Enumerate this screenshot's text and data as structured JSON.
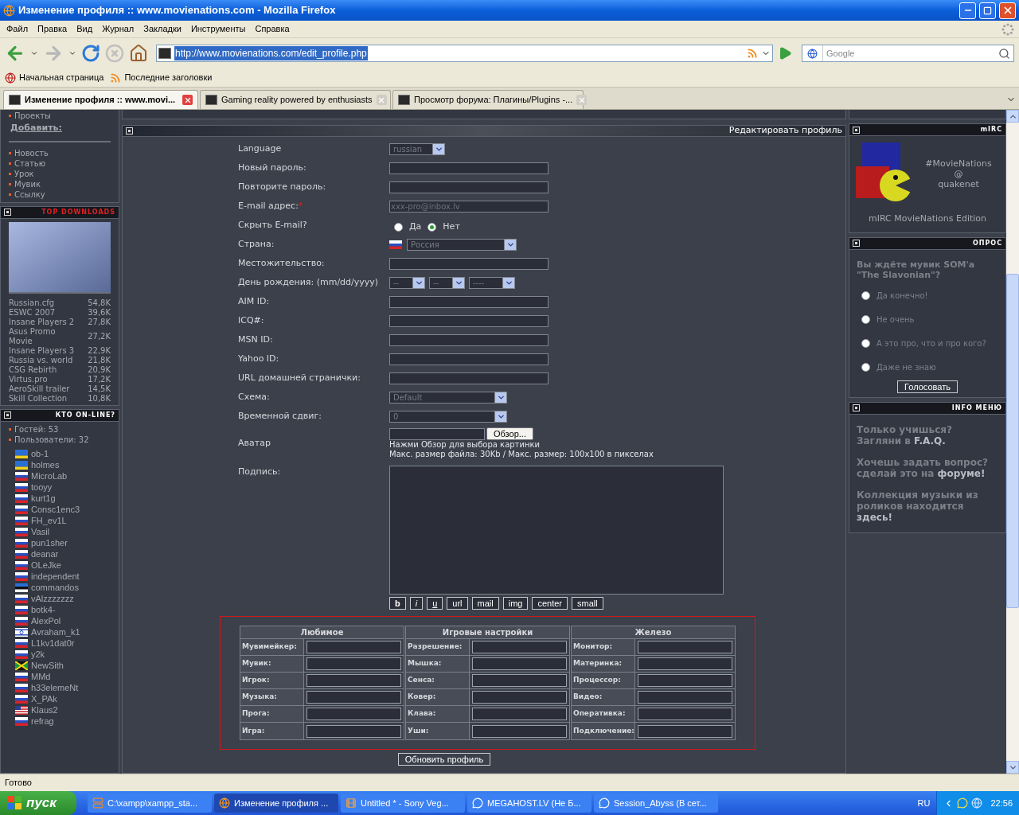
{
  "window": {
    "title": "Изменение профиля :: www.movienations.com - Mozilla Firefox"
  },
  "menu": [
    "Файл",
    "Правка",
    "Вид",
    "Журнал",
    "Закладки",
    "Инструменты",
    "Справка"
  ],
  "address": {
    "value": "http://www.movienations.com/edit_profile.php"
  },
  "search": {
    "placeholder": "Google"
  },
  "bookmarks": [
    "Начальная страница",
    "Последние заголовки"
  ],
  "tabs": [
    {
      "label": "Изменение профиля :: www.movi...",
      "selected": true
    },
    {
      "label": "Gaming reality powered by enthusiasts",
      "selected": false
    },
    {
      "label": "Просмотр форума: Плагины/Plugins -...",
      "selected": false
    }
  ],
  "left": {
    "links_top": [
      "Проекты"
    ],
    "add_title": "Добавить:",
    "add_links": [
      "Новость",
      "Статью",
      "Урок",
      "Мувик",
      "Ссылку"
    ],
    "downloads": {
      "title": "TOP DOWNLOADS",
      "items": [
        {
          "name": "Russian.cfg",
          "size": "54,8K"
        },
        {
          "name": "ESWC 2007",
          "size": "39,6K"
        },
        {
          "name": "Insane Players 2",
          "size": "27,8K"
        },
        {
          "name": "Asus Promo Movie",
          "size": "27,2K"
        },
        {
          "name": "Insane Players 3",
          "size": "22,9K"
        },
        {
          "name": "Russia vs. world",
          "size": "21,8K"
        },
        {
          "name": "CSG Rebirth",
          "size": "20,9K"
        },
        {
          "name": "Virtus.pro",
          "size": "17,2K"
        },
        {
          "name": "AeroSkill trailer",
          "size": "14,5K"
        },
        {
          "name": "Skill Collection",
          "size": "10,8K"
        }
      ]
    },
    "online": {
      "title": "КТО ON-LINE?",
      "stats": [
        "Гостей: 53",
        "Пользователи: 32"
      ],
      "users": [
        {
          "name": "ob-1",
          "kind": "ua"
        },
        {
          "name": "holmes",
          "kind": "ua"
        },
        {
          "name": "MicroLab",
          "kind": "ru"
        },
        {
          "name": "tooyy",
          "kind": "ru"
        },
        {
          "name": "kurt1g",
          "kind": "ru"
        },
        {
          "name": "Consc1enc3",
          "kind": "ru"
        },
        {
          "name": "FH_ev1L",
          "kind": "ru"
        },
        {
          "name": "Vasil",
          "kind": "ru"
        },
        {
          "name": "pun1sher",
          "kind": "ru"
        },
        {
          "name": "deanar",
          "kind": "ru"
        },
        {
          "name": "OLeJke",
          "kind": "ru"
        },
        {
          "name": "independent",
          "kind": "ru"
        },
        {
          "name": "commandos",
          "kind": "ee"
        },
        {
          "name": "vAlzzzzzzz",
          "kind": "ru"
        },
        {
          "name": "botk4-",
          "kind": "ru"
        },
        {
          "name": "AlexPol",
          "kind": "ru"
        },
        {
          "name": "Avraham_k1",
          "kind": "il"
        },
        {
          "name": "L1kv1dat0r",
          "kind": "ru"
        },
        {
          "name": "y2k",
          "kind": "ru"
        },
        {
          "name": "NewSith",
          "kind": "jm"
        },
        {
          "name": "MMd",
          "kind": "ru"
        },
        {
          "name": "h33elemeNt",
          "kind": "ru"
        },
        {
          "name": "X_PAk",
          "kind": "ru"
        },
        {
          "name": "Klaus2",
          "kind": "us"
        },
        {
          "name": "refrag",
          "kind": "ru"
        }
      ]
    }
  },
  "main": {
    "title": "Редактировать профиль",
    "fields": [
      {
        "kind": "select",
        "label": "Language",
        "value": "russian"
      },
      {
        "kind": "input",
        "label": "Новый пароль:"
      },
      {
        "kind": "input",
        "label": "Повторите пароль:"
      },
      {
        "kind": "input",
        "label": "E-mail адрес:",
        "mark": "*",
        "value": "xxx-pro@inbox.lv"
      },
      {
        "kind": "radio",
        "label": "Скрыть E-mail?",
        "options": [
          {
            "label": "Да",
            "selected": false
          },
          {
            "label": "Нет",
            "selected": true
          }
        ]
      },
      {
        "kind": "country",
        "label": "Страна:",
        "value": "Россия"
      },
      {
        "kind": "input",
        "label": "Местожительство:"
      },
      {
        "kind": "date",
        "label": "День рождения: (mm/dd/yyyy)",
        "parts": [
          "--",
          "--",
          "----"
        ]
      },
      {
        "kind": "input",
        "label": "AIM ID:"
      },
      {
        "kind": "input",
        "label": "ICQ#:"
      },
      {
        "kind": "input",
        "label": "MSN ID:"
      },
      {
        "kind": "input",
        "label": "Yahoo ID:"
      },
      {
        "kind": "input",
        "label": "URL домашней странички:"
      },
      {
        "kind": "select",
        "label": "Схема:",
        "value": "Default"
      },
      {
        "kind": "select",
        "label": "Временной сдвиг:",
        "value": "0"
      },
      {
        "kind": "file",
        "label": "Аватар",
        "button": "Обзор...",
        "hints": [
          "Нажми Обзор для выбора картинки",
          "Макс. размер файла: 30Kb / Макс. размер: 100x100 в пикселах"
        ]
      }
    ],
    "signature": {
      "label": "Подпись:",
      "buttons": [
        "b",
        "i",
        "u",
        "url",
        "mail",
        "img",
        "center",
        "small"
      ]
    },
    "groups": [
      {
        "title": "Любимое",
        "rows": [
          "Мувимейкер:",
          "Мувик:",
          "Игрок:",
          "Музыка:",
          "Прога:",
          "Игра:"
        ]
      },
      {
        "title": "Игровые настройки",
        "rows": [
          "Разрешение:",
          "Мышка:",
          "Сенса:",
          "Ковер:",
          "Клава:",
          "Уши:"
        ]
      },
      {
        "title": "Железо",
        "rows": [
          "Монитор:",
          "Материнка:",
          "Процессор:",
          "Видео:",
          "Оперативка:",
          "Подключение:"
        ]
      }
    ],
    "submit": "Обновить профиль"
  },
  "right": {
    "mirc": {
      "title": "mIRC",
      "lines": [
        "#MovieNations",
        "@",
        "quakenet"
      ],
      "caption": "mIRC MovieNations Edition"
    },
    "poll": {
      "title": "ОПРОС",
      "question": "Вы ждёте мувик SOM'a \"The Slavonian\"?",
      "options": [
        {
          "label": "Да конечно!",
          "selected": false
        },
        {
          "label": "Не очень",
          "selected": false
        },
        {
          "label": "А это про, что и про кого?",
          "selected": false
        },
        {
          "label": "Даже не знаю",
          "selected": false
        }
      ],
      "button": "Голосовать"
    },
    "info": {
      "title": "INFO МЕНЮ",
      "items": [
        {
          "text": "Только учишься? Загляни в",
          "link": "F.A.Q."
        },
        {
          "text": "Хочешь задать вопрос? сделай это на",
          "link": "форуме!"
        },
        {
          "text": "Коллекция музыки из роликов находится",
          "link": "здесь!"
        }
      ]
    }
  },
  "status": "Готово",
  "taskbar": {
    "start": "пуск",
    "tasks": [
      {
        "label": "C:\\xampp\\xampp_sta...",
        "kind": "xampp",
        "selected": false
      },
      {
        "label": "Изменение профиля ...",
        "kind": "firefox",
        "selected": true
      },
      {
        "label": "Untitled * - Sony Veg...",
        "kind": "vegas",
        "selected": false
      },
      {
        "label": "MEGAHOST.LV (Не Б...",
        "kind": "chat",
        "selected": false
      },
      {
        "label": "Session_Abyss (В сет...",
        "kind": "chat",
        "selected": false
      }
    ],
    "lang": "RU",
    "clock": "22:56"
  }
}
